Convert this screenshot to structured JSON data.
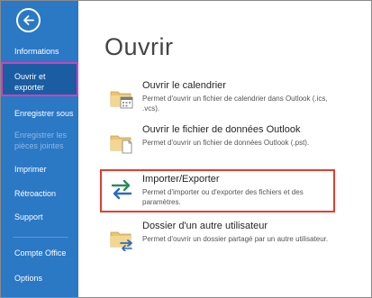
{
  "colors": {
    "sidebar": "#2b78c5",
    "selected_border": "#d63eb8",
    "highlight_border": "#e43d2f"
  },
  "sidebar": {
    "back_icon": "back-arrow-icon",
    "items": [
      {
        "label": "Informations"
      },
      {
        "label": "Ouvrir et exporter",
        "selected": true
      },
      {
        "label": "Enregistrer sous"
      },
      {
        "label": "Enregistrer les pièces jointes",
        "disabled": true
      },
      {
        "label": "Imprimer"
      },
      {
        "label": "Rétroaction"
      },
      {
        "label": "Support"
      },
      {
        "label": "Compte Office"
      },
      {
        "label": "Options"
      }
    ]
  },
  "main": {
    "title": "Ouvrir",
    "actions": [
      {
        "title": "Ouvrir le calendrier",
        "desc": "Permet d'ouvrir un fichier de calendrier dans Outlook (.ics, .vcs).",
        "icon": "folder-calendar-icon"
      },
      {
        "title": "Ouvrir le fichier de données Outlook",
        "desc": "Permet d'ouvrir un fichier de données Outlook (.pst).",
        "icon": "folder-data-file-icon"
      },
      {
        "title": "Importer/Exporter",
        "desc": "Permet d'importer ou d'exporter des fichiers et des paramètres.",
        "icon": "import-export-arrows-icon",
        "highlighted": true
      },
      {
        "title": "Dossier d'un autre utilisateur",
        "desc": "Permet d'ouvrir un dossier partagé par un autre utilisateur.",
        "icon": "folder-shared-icon"
      }
    ]
  }
}
